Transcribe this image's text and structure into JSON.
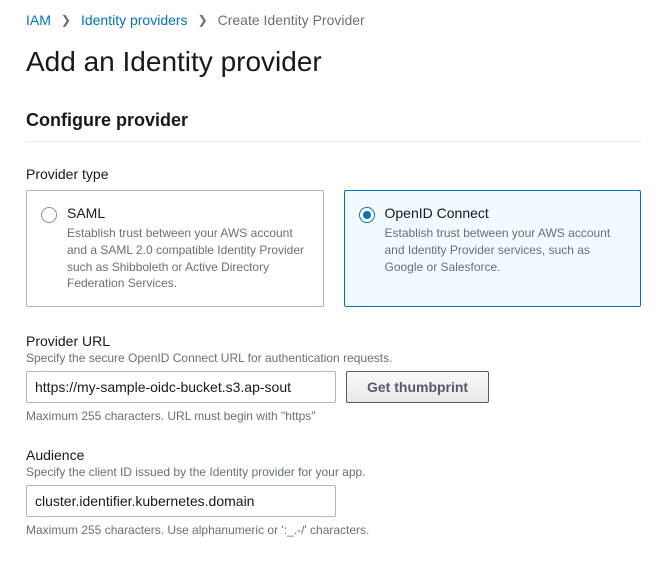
{
  "breadcrumb": {
    "items": [
      {
        "label": "IAM",
        "link": true
      },
      {
        "label": "Identity providers",
        "link": true
      },
      {
        "label": "Create Identity Provider",
        "link": false
      }
    ]
  },
  "page_title": "Add an Identity provider",
  "section_title": "Configure provider",
  "provider_type": {
    "label": "Provider type",
    "options": [
      {
        "title": "SAML",
        "description": "Establish trust between your AWS account and a SAML 2.0 compatible Identity Provider such as Shibboleth or Active Directory Federation Services.",
        "selected": false
      },
      {
        "title": "OpenID Connect",
        "description": "Establish trust between your AWS account and Identity Provider services, such as Google or Salesforce.",
        "selected": true
      }
    ]
  },
  "provider_url": {
    "label": "Provider URL",
    "hint": "Specify the secure OpenID Connect URL for authentication requests.",
    "value": "https://my-sample-oidc-bucket.s3.ap-sout",
    "button_label": "Get thumbprint",
    "constraint": "Maximum 255 characters. URL must begin with \"https\""
  },
  "audience": {
    "label": "Audience",
    "hint": "Specify the client ID issued by the Identity provider for your app.",
    "value": "cluster.identifier.kubernetes.domain",
    "constraint": "Maximum 255 characters. Use alphanumeric or ':_.-/' characters."
  }
}
